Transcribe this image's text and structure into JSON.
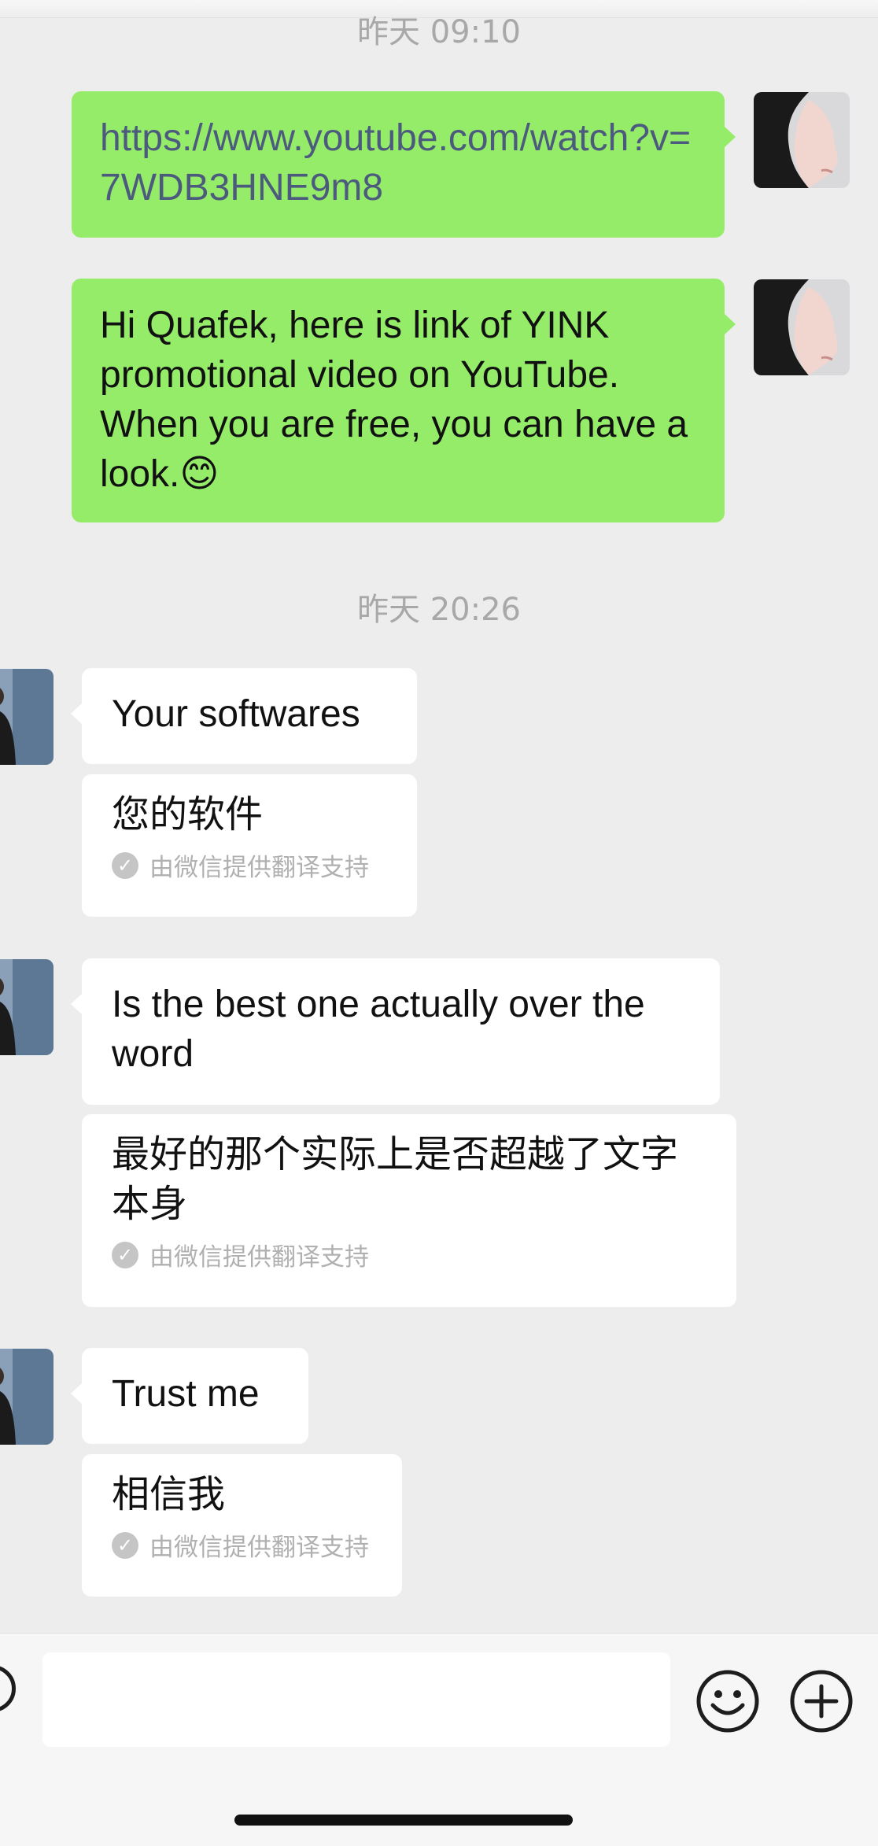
{
  "chat": {
    "messages": [
      {
        "kind": "time",
        "text": "昨天 09:10"
      },
      {
        "kind": "out",
        "text": "https://www.youtube.com/watch?v=7WDB3HNE9m8",
        "is_link": true
      },
      {
        "kind": "out",
        "text": "Hi Quafek, here is link of YINK promotional video on YouTube. When you are free, you can have a look.😊"
      },
      {
        "kind": "time",
        "text": "昨天 20:26"
      },
      {
        "kind": "in",
        "text": "Your softwares",
        "translation": "您的软件",
        "credit": "由微信提供翻译支持"
      },
      {
        "kind": "in",
        "text": "Is the best one actually over the word",
        "translation": "最好的那个实际上是否超越了文字本身",
        "credit": "由微信提供翻译支持"
      },
      {
        "kind": "in",
        "text": "Trust me",
        "translation": "相信我",
        "credit": "由微信提供翻译支持"
      }
    ]
  },
  "input_bar": {
    "placeholder": "",
    "icons": [
      "voice-icon",
      "emoji-icon",
      "plus-icon"
    ]
  },
  "colors": {
    "background": "#ededed",
    "outgoing_bubble": "#95ec69",
    "incoming_bubble": "#ffffff",
    "link": "#4c5b7d"
  }
}
